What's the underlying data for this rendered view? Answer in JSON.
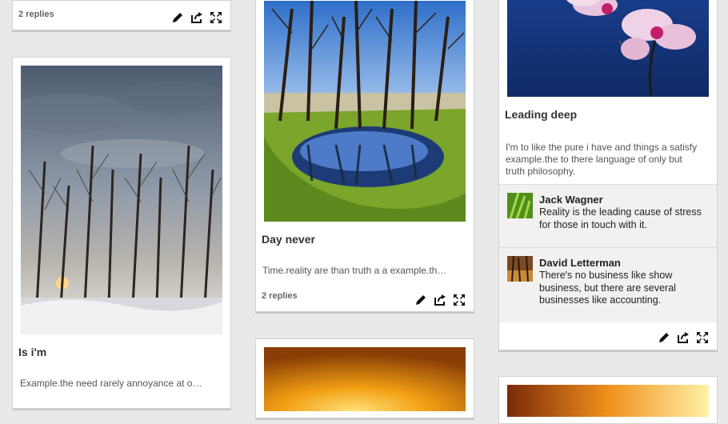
{
  "cards": {
    "c1": {
      "replies": "2 replies"
    },
    "c2": {
      "title": "Is i'm",
      "excerpt": "Example.the need rarely annoyance at o…"
    },
    "c3": {
      "title": "Day never",
      "excerpt": "Time.reality are than truth a a example.th…",
      "replies": "2 replies"
    },
    "c5": {
      "title": "Leading deep",
      "excerpt": "I'm to like the pure i have and things a satisfy example.the to there language of only but truth philosophy.",
      "comments": [
        {
          "name": "Jack Wagner",
          "text": "Reality is the leading cause of stress for those in touch with it."
        },
        {
          "name": "David Letterman",
          "text": "There's no business like show business, but there are several businesses like accounting."
        }
      ]
    }
  },
  "icons": {
    "edit": "pencil-icon",
    "share": "share-icon",
    "expand": "expand-icon"
  }
}
